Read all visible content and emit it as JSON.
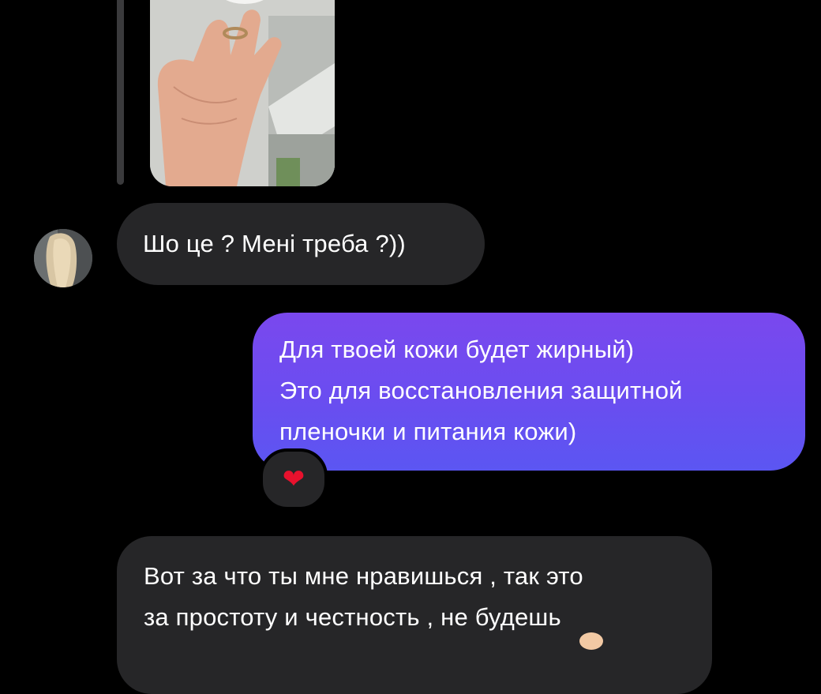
{
  "thread": {
    "incoming_photo": {
      "icon": "photo-hand-holding-jar"
    },
    "messages": [
      {
        "from": "contact",
        "lines": [
          "Шо це ? Мені треба ?))"
        ]
      },
      {
        "from": "me",
        "lines": [
          "Для твоей кожи будет жирный)",
          "Это для восстановления защитной",
          "пленочки и питания кожи)"
        ],
        "reaction": "❤"
      },
      {
        "from": "contact",
        "lines": [
          "Вот за что ты мне нравишься , так это",
          "за простоту и честность , не будешь"
        ]
      }
    ]
  },
  "colors": {
    "background": "#000000",
    "incoming_bubble": "#262628",
    "outgoing_bubble_top": "#7a48ee",
    "outgoing_bubble_bottom": "#5b56f2",
    "reaction_heart": "#e8112d"
  }
}
